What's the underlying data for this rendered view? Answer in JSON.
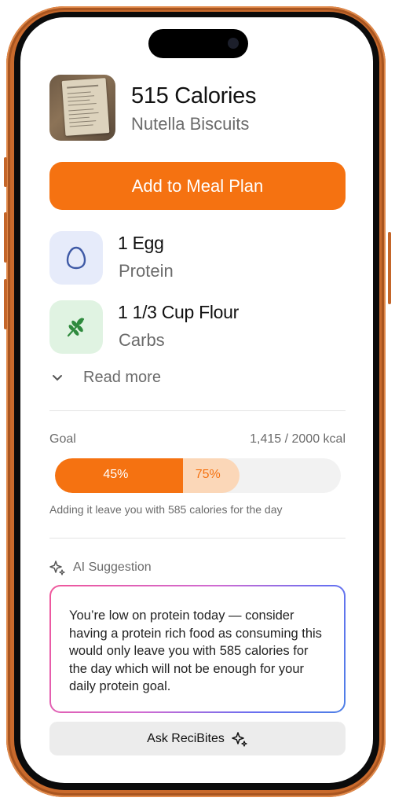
{
  "recipe": {
    "calories_title": "515 Calories",
    "name": "Nutella Biscuits",
    "thumbnail_icon": "recipe-card-photo"
  },
  "actions": {
    "add_to_meal_plan": "Add to Meal Plan",
    "read_more": "Read more",
    "ask": "Ask ReciBites"
  },
  "ingredients": [
    {
      "name": "1 Egg",
      "category": "Protein",
      "icon": "egg-icon",
      "bg": "#e6ebfa",
      "color": "#3f5aa6"
    },
    {
      "name": "1 1/3 Cup Flour",
      "category": "Carbs",
      "icon": "wheat-icon",
      "bg": "#e0f3e2",
      "color": "#2f8a3e"
    }
  ],
  "goal": {
    "label": "Goal",
    "value": "1,415 / 2000 kcal",
    "current_percent": 45,
    "after_percent": 75,
    "current_label": "45%",
    "after_label": "75%",
    "note": "Adding it leave you with 585 calories for the day"
  },
  "ai": {
    "label": "AI Suggestion",
    "icon": "sparkles-icon",
    "message": "You’re low on protein today — consider having a protein rich food as consuming this would only leave you with 585 calories for the day which will not be enough for your daily protein goal."
  },
  "colors": {
    "accent": "#f57211",
    "accent_light": "#fbd7b8"
  }
}
